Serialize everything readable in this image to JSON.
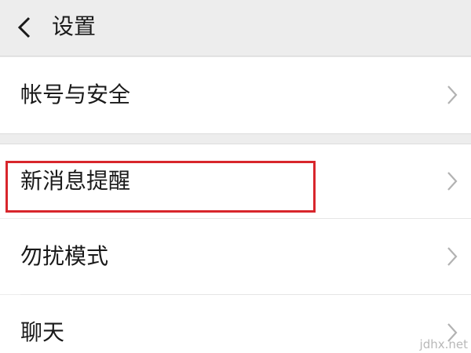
{
  "header": {
    "back_icon": "chevron-left-icon",
    "title": "设置"
  },
  "groups": [
    {
      "items": [
        {
          "label": "帐号与安全",
          "icon": "chevron-right-icon"
        }
      ]
    },
    {
      "items": [
        {
          "label": "新消息提醒",
          "icon": "chevron-right-icon",
          "highlighted": true
        },
        {
          "label": "勿扰模式",
          "icon": "chevron-right-icon"
        },
        {
          "label": "聊天",
          "icon": "chevron-right-icon"
        }
      ]
    }
  ],
  "colors": {
    "background": "#ededed",
    "row_background": "#ffffff",
    "highlight": "#d8262c",
    "chevron": "#b2b2b2"
  },
  "watermark": "jdhx.net"
}
